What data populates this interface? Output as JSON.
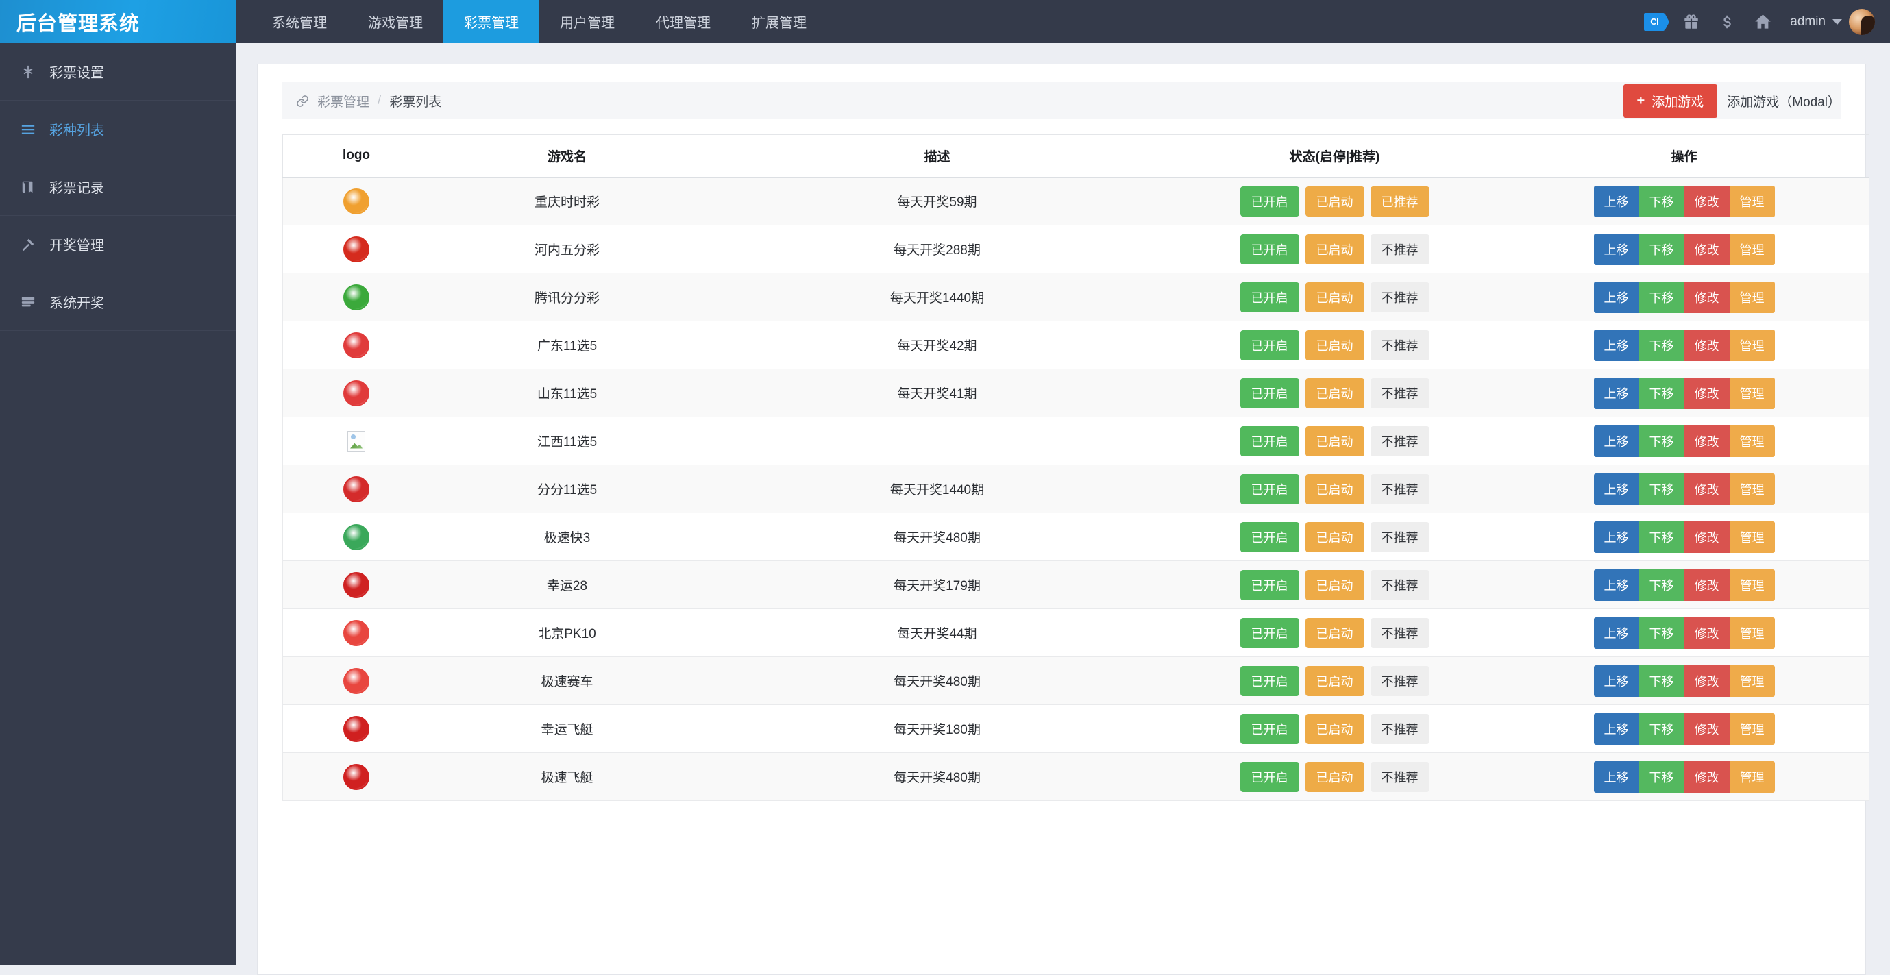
{
  "brand": {
    "title": "后台管理系统"
  },
  "topnav": {
    "items": [
      {
        "label": "系统管理",
        "active": false
      },
      {
        "label": "游戏管理",
        "active": false
      },
      {
        "label": "彩票管理",
        "active": true
      },
      {
        "label": "用户管理",
        "active": false
      },
      {
        "label": "代理管理",
        "active": false
      },
      {
        "label": "扩展管理",
        "active": false
      }
    ],
    "ci_badge": "CI",
    "user": "admin"
  },
  "sidebar": {
    "items": [
      {
        "label": "彩票设置",
        "icon": "asterisk-icon",
        "active": false
      },
      {
        "label": "彩种列表",
        "icon": "list-icon",
        "active": true
      },
      {
        "label": "彩票记录",
        "icon": "book-icon",
        "active": false
      },
      {
        "label": "开奖管理",
        "icon": "hammer-icon",
        "active": false
      },
      {
        "label": "系统开奖",
        "icon": "server-icon",
        "active": false
      }
    ]
  },
  "breadcrumb": {
    "parent": "彩票管理",
    "separator": "/",
    "current": "彩票列表"
  },
  "toolbar": {
    "add_label": "添加游戏",
    "plus": "+",
    "modal_label": "添加游戏（Modal）"
  },
  "table": {
    "headers": [
      "logo",
      "游戏名",
      "描述",
      "状态(启停|推荐)",
      "操作"
    ],
    "actions": [
      "上移",
      "下移",
      "修改",
      "管理"
    ],
    "rows": [
      {
        "name": "重庆时时彩",
        "desc": "每天开奖59期",
        "enabled": "已开启",
        "started": "已启动",
        "recommend": "已推荐",
        "recommended": true,
        "logo_type": "image",
        "logo_color": "#f0a030"
      },
      {
        "name": "河内五分彩",
        "desc": "每天开奖288期",
        "enabled": "已开启",
        "started": "已启动",
        "recommend": "不推荐",
        "recommended": false,
        "logo_type": "image",
        "logo_color": "#d52b1e"
      },
      {
        "name": "腾讯分分彩",
        "desc": "每天开奖1440期",
        "enabled": "已开启",
        "started": "已启动",
        "recommend": "不推荐",
        "recommended": false,
        "logo_type": "image",
        "logo_color": "#3ba93b"
      },
      {
        "name": "广东11选5",
        "desc": "每天开奖42期",
        "enabled": "已开启",
        "started": "已启动",
        "recommend": "不推荐",
        "recommended": false,
        "logo_type": "image",
        "logo_color": "#e03b3b"
      },
      {
        "name": "山东11选5",
        "desc": "每天开奖41期",
        "enabled": "已开启",
        "started": "已启动",
        "recommend": "不推荐",
        "recommended": false,
        "logo_type": "image",
        "logo_color": "#e03b3b"
      },
      {
        "name": "江西11选5",
        "desc": "",
        "enabled": "已开启",
        "started": "已启动",
        "recommend": "不推荐",
        "recommended": false,
        "logo_type": "broken",
        "logo_color": ""
      },
      {
        "name": "分分11选5",
        "desc": "每天开奖1440期",
        "enabled": "已开启",
        "started": "已启动",
        "recommend": "不推荐",
        "recommended": false,
        "logo_type": "image",
        "logo_color": "#d42b2b"
      },
      {
        "name": "极速快3",
        "desc": "每天开奖480期",
        "enabled": "已开启",
        "started": "已启动",
        "recommend": "不推荐",
        "recommended": false,
        "logo_type": "image",
        "logo_color": "#3aa85a"
      },
      {
        "name": "幸运28",
        "desc": "每天开奖179期",
        "enabled": "已开启",
        "started": "已启动",
        "recommend": "不推荐",
        "recommended": false,
        "logo_type": "image",
        "logo_color": "#cf2222"
      },
      {
        "name": "北京PK10",
        "desc": "每天开奖44期",
        "enabled": "已开启",
        "started": "已启动",
        "recommend": "不推荐",
        "recommended": false,
        "logo_type": "image",
        "logo_color": "#e8463f"
      },
      {
        "name": "极速赛车",
        "desc": "每天开奖480期",
        "enabled": "已开启",
        "started": "已启动",
        "recommend": "不推荐",
        "recommended": false,
        "logo_type": "image",
        "logo_color": "#e8463f"
      },
      {
        "name": "幸运飞艇",
        "desc": "每天开奖180期",
        "enabled": "已开启",
        "started": "已启动",
        "recommend": "不推荐",
        "recommended": false,
        "logo_type": "image",
        "logo_color": "#d02020"
      },
      {
        "name": "极速飞艇",
        "desc": "每天开奖480期",
        "enabled": "已开启",
        "started": "已启动",
        "recommend": "不推荐",
        "recommended": false,
        "logo_type": "image",
        "logo_color": "#d02020"
      }
    ]
  },
  "colors": {
    "brand_blue": "#1d9cdf",
    "dark": "#343a4a",
    "danger": "#e04a3f",
    "success": "#51b95c",
    "warning": "#eeab47"
  }
}
